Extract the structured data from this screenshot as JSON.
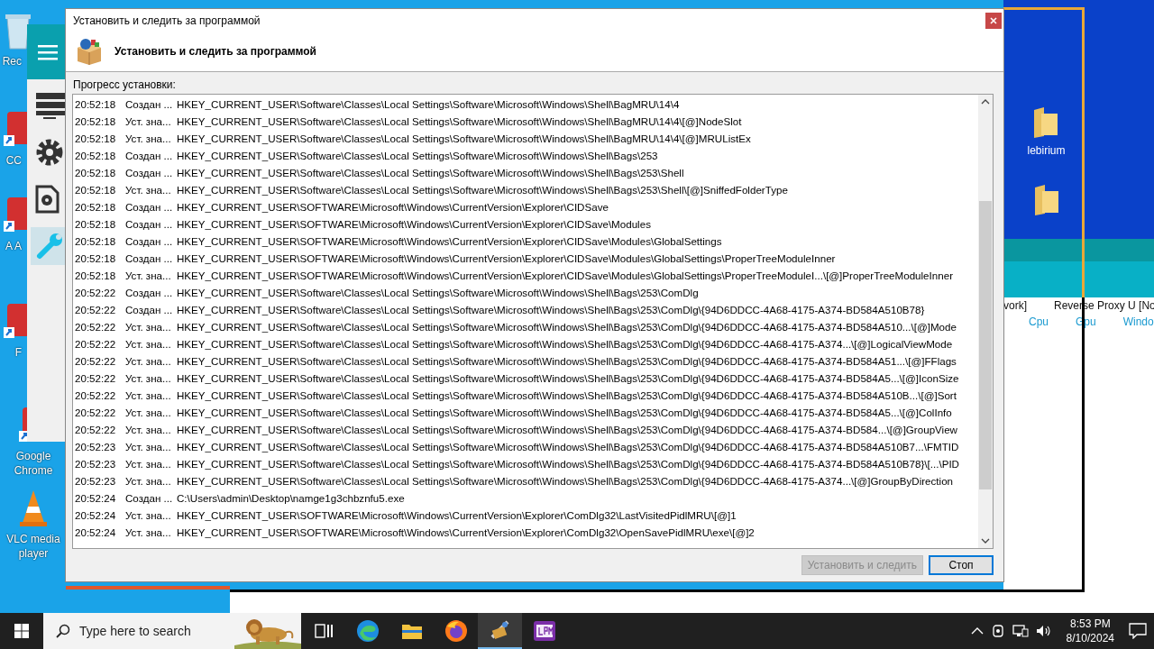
{
  "desktop_icons": [
    {
      "label": "Rec",
      "kind": "bin"
    },
    {
      "label": "CC",
      "kind": "shortcut"
    },
    {
      "label": "A A",
      "kind": "shortcut"
    },
    {
      "label": "F",
      "kind": "shortcut"
    },
    {
      "label": "Google Chrome",
      "kind": "shortcut"
    },
    {
      "label": "VLC media player",
      "kind": "cone"
    }
  ],
  "side_app": {
    "nav": [
      {
        "kind": "server",
        "selected": false
      },
      {
        "kind": "gear",
        "selected": false
      },
      {
        "kind": "doc",
        "selected": false
      },
      {
        "kind": "wrench",
        "selected": true
      }
    ]
  },
  "right_app": {
    "folders": [
      {
        "kind": "folder",
        "label": "lebirium"
      },
      {
        "kind": "folder"
      }
    ],
    "header": [
      "vork]",
      "Reverse Proxy U [No"
    ],
    "columns": [
      "Cpu",
      "Gpu",
      "Windo"
    ]
  },
  "dialog": {
    "title": "Установить и следить за программой",
    "heading": "Установить и следить за программой",
    "progress_label": "Прогресс установки:",
    "log": [
      {
        "time": "20:52:18",
        "action": "Создан ...",
        "path": "HKEY_CURRENT_USER\\Software\\Classes\\Local Settings\\Software\\Microsoft\\Windows\\Shell\\BagMRU\\14\\4"
      },
      {
        "time": "20:52:18",
        "action": "Уст. зна...",
        "path": "HKEY_CURRENT_USER\\Software\\Classes\\Local Settings\\Software\\Microsoft\\Windows\\Shell\\BagMRU\\14\\4\\[@]NodeSlot"
      },
      {
        "time": "20:52:18",
        "action": "Уст. зна...",
        "path": "HKEY_CURRENT_USER\\Software\\Classes\\Local Settings\\Software\\Microsoft\\Windows\\Shell\\BagMRU\\14\\4\\[@]MRUListEx"
      },
      {
        "time": "20:52:18",
        "action": "Создан ...",
        "path": "HKEY_CURRENT_USER\\Software\\Classes\\Local Settings\\Software\\Microsoft\\Windows\\Shell\\Bags\\253"
      },
      {
        "time": "20:52:18",
        "action": "Создан ...",
        "path": "HKEY_CURRENT_USER\\Software\\Classes\\Local Settings\\Software\\Microsoft\\Windows\\Shell\\Bags\\253\\Shell"
      },
      {
        "time": "20:52:18",
        "action": "Уст. зна...",
        "path": "HKEY_CURRENT_USER\\Software\\Classes\\Local Settings\\Software\\Microsoft\\Windows\\Shell\\Bags\\253\\Shell\\[@]SniffedFolderType"
      },
      {
        "time": "20:52:18",
        "action": "Создан ...",
        "path": "HKEY_CURRENT_USER\\SOFTWARE\\Microsoft\\Windows\\CurrentVersion\\Explorer\\CIDSave"
      },
      {
        "time": "20:52:18",
        "action": "Создан ...",
        "path": "HKEY_CURRENT_USER\\SOFTWARE\\Microsoft\\Windows\\CurrentVersion\\Explorer\\CIDSave\\Modules"
      },
      {
        "time": "20:52:18",
        "action": "Создан ...",
        "path": "HKEY_CURRENT_USER\\SOFTWARE\\Microsoft\\Windows\\CurrentVersion\\Explorer\\CIDSave\\Modules\\GlobalSettings"
      },
      {
        "time": "20:52:18",
        "action": "Создан ...",
        "path": "HKEY_CURRENT_USER\\SOFTWARE\\Microsoft\\Windows\\CurrentVersion\\Explorer\\CIDSave\\Modules\\GlobalSettings\\ProperTreeModuleInner"
      },
      {
        "time": "20:52:18",
        "action": "Уст. зна...",
        "path": "HKEY_CURRENT_USER\\SOFTWARE\\Microsoft\\Windows\\CurrentVersion\\Explorer\\CIDSave\\Modules\\GlobalSettings\\ProperTreeModuleI...\\[@]ProperTreeModuleInner"
      },
      {
        "time": "20:52:22",
        "action": "Создан ...",
        "path": "HKEY_CURRENT_USER\\Software\\Classes\\Local Settings\\Software\\Microsoft\\Windows\\Shell\\Bags\\253\\ComDlg"
      },
      {
        "time": "20:52:22",
        "action": "Создан ...",
        "path": "HKEY_CURRENT_USER\\Software\\Classes\\Local Settings\\Software\\Microsoft\\Windows\\Shell\\Bags\\253\\ComDlg\\{94D6DDCC-4A68-4175-A374-BD584A510B78}"
      },
      {
        "time": "20:52:22",
        "action": "Уст. зна...",
        "path": "HKEY_CURRENT_USER\\Software\\Classes\\Local Settings\\Software\\Microsoft\\Windows\\Shell\\Bags\\253\\ComDlg\\{94D6DDCC-4A68-4175-A374-BD584A510...\\[@]Mode"
      },
      {
        "time": "20:52:22",
        "action": "Уст. зна...",
        "path": "HKEY_CURRENT_USER\\Software\\Classes\\Local Settings\\Software\\Microsoft\\Windows\\Shell\\Bags\\253\\ComDlg\\{94D6DDCC-4A68-4175-A374...\\[@]LogicalViewMode"
      },
      {
        "time": "20:52:22",
        "action": "Уст. зна...",
        "path": "HKEY_CURRENT_USER\\Software\\Classes\\Local Settings\\Software\\Microsoft\\Windows\\Shell\\Bags\\253\\ComDlg\\{94D6DDCC-4A68-4175-A374-BD584A51...\\[@]FFlags"
      },
      {
        "time": "20:52:22",
        "action": "Уст. зна...",
        "path": "HKEY_CURRENT_USER\\Software\\Classes\\Local Settings\\Software\\Microsoft\\Windows\\Shell\\Bags\\253\\ComDlg\\{94D6DDCC-4A68-4175-A374-BD584A5...\\[@]IconSize"
      },
      {
        "time": "20:52:22",
        "action": "Уст. зна...",
        "path": "HKEY_CURRENT_USER\\Software\\Classes\\Local Settings\\Software\\Microsoft\\Windows\\Shell\\Bags\\253\\ComDlg\\{94D6DDCC-4A68-4175-A374-BD584A510B...\\[@]Sort"
      },
      {
        "time": "20:52:22",
        "action": "Уст. зна...",
        "path": "HKEY_CURRENT_USER\\Software\\Classes\\Local Settings\\Software\\Microsoft\\Windows\\Shell\\Bags\\253\\ComDlg\\{94D6DDCC-4A68-4175-A374-BD584A5...\\[@]ColInfo"
      },
      {
        "time": "20:52:22",
        "action": "Уст. зна...",
        "path": "HKEY_CURRENT_USER\\Software\\Classes\\Local Settings\\Software\\Microsoft\\Windows\\Shell\\Bags\\253\\ComDlg\\{94D6DDCC-4A68-4175-A374-BD584...\\[@]GroupView"
      },
      {
        "time": "20:52:23",
        "action": "Уст. зна...",
        "path": "HKEY_CURRENT_USER\\Software\\Classes\\Local Settings\\Software\\Microsoft\\Windows\\Shell\\Bags\\253\\ComDlg\\{94D6DDCC-4A68-4175-A374-BD584A510B7...\\FMTID"
      },
      {
        "time": "20:52:23",
        "action": "Уст. зна...",
        "path": "HKEY_CURRENT_USER\\Software\\Classes\\Local Settings\\Software\\Microsoft\\Windows\\Shell\\Bags\\253\\ComDlg\\{94D6DDCC-4A68-4175-A374-BD584A510B78}\\[...\\PID"
      },
      {
        "time": "20:52:23",
        "action": "Уст. зна...",
        "path": "HKEY_CURRENT_USER\\Software\\Classes\\Local Settings\\Software\\Microsoft\\Windows\\Shell\\Bags\\253\\ComDlg\\{94D6DDCC-4A68-4175-A374...\\[@]GroupByDirection"
      },
      {
        "time": "20:52:24",
        "action": "Создан ...",
        "path": "C:\\Users\\admin\\Desktop\\namge1g3chbznfu5.exe"
      },
      {
        "time": "20:52:24",
        "action": "Уст. зна...",
        "path": "HKEY_CURRENT_USER\\SOFTWARE\\Microsoft\\Windows\\CurrentVersion\\Explorer\\ComDlg32\\LastVisitedPidlMRU\\[@]1"
      },
      {
        "time": "20:52:24",
        "action": "Уст. зна...",
        "path": "HKEY_CURRENT_USER\\SOFTWARE\\Microsoft\\Windows\\CurrentVersion\\Explorer\\ComDlg32\\OpenSavePidlMRU\\exe\\[@]2"
      }
    ],
    "buttons": [
      {
        "label": "Установить и следить",
        "disabled": true,
        "focused": false
      },
      {
        "label": "Стоп",
        "disabled": false,
        "focused": true
      }
    ]
  },
  "taskbar": {
    "search_placeholder": "Type here to search",
    "apps": [
      {
        "kind": "taskview",
        "selected": false
      },
      {
        "kind": "edge",
        "selected": false
      },
      {
        "kind": "explorer",
        "selected": false
      },
      {
        "kind": "firefox",
        "selected": false
      },
      {
        "kind": "installer",
        "selected": true
      },
      {
        "kind": "lrm",
        "selected": false
      }
    ],
    "time": "8:53 PM",
    "date": "8/10/2024"
  }
}
